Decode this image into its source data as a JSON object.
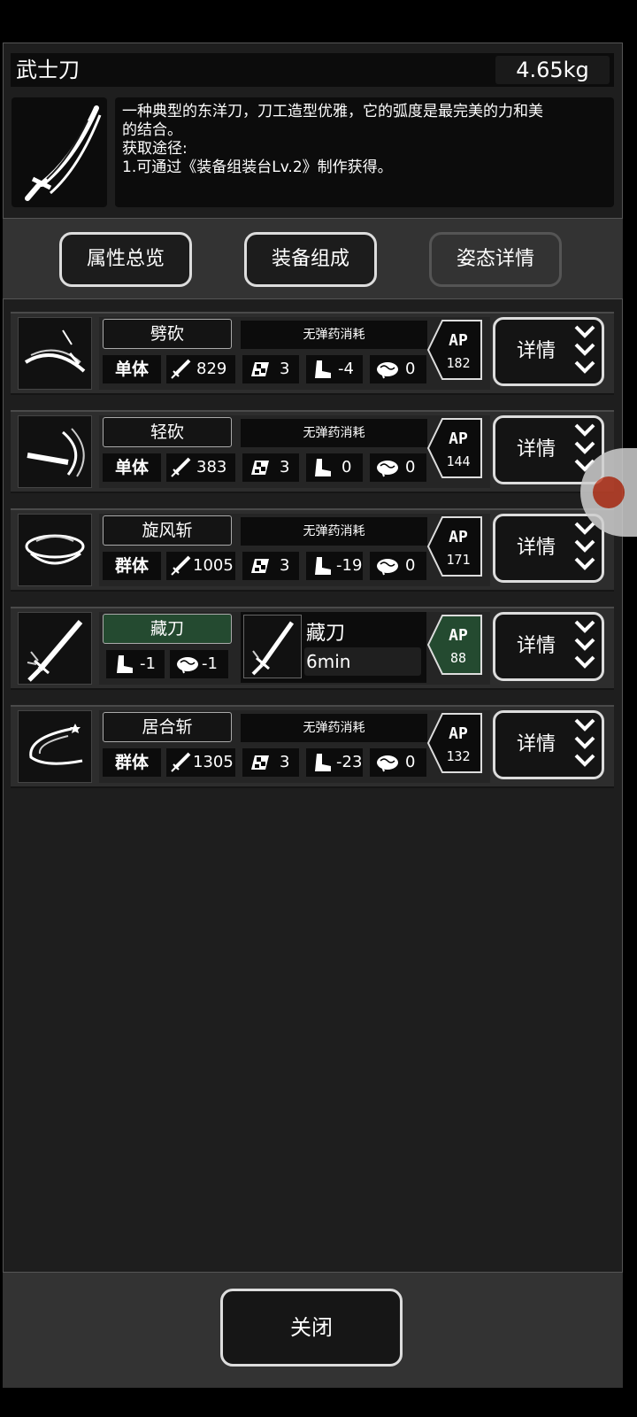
{
  "item": {
    "name": "武士刀",
    "weight": "4.65kg",
    "description_lines": [
      "一种典型的东洋刀，刀工造型优雅，它的弧度是最完美的力和美",
      "的结合。",
      "获取途径:",
      "1.可通过《装备组装台Lv.2》制作获得。"
    ]
  },
  "tabs": [
    {
      "label": "属性总览"
    },
    {
      "label": "装备组成"
    },
    {
      "label": "姿态详情",
      "selected": true
    }
  ],
  "skills": [
    {
      "name": "劈砍",
      "ammo": "无弹药消耗",
      "target": "单体",
      "attack": "829",
      "speed": "3",
      "move": "-4",
      "brain": "0",
      "ap_label": "AP",
      "ap": "182",
      "detail": "详情"
    },
    {
      "name": "轻砍",
      "ammo": "无弹药消耗",
      "target": "单体",
      "attack": "383",
      "speed": "3",
      "move": "0",
      "brain": "0",
      "ap_label": "AP",
      "ap": "144",
      "detail": "详情"
    },
    {
      "name": "旋风斩",
      "ammo": "无弹药消耗",
      "target": "群体",
      "attack": "1005",
      "speed": "3",
      "move": "-19",
      "brain": "0",
      "ap_label": "AP",
      "ap": "171",
      "detail": "详情"
    },
    {
      "name": "藏刀",
      "stance_name": "藏刀",
      "stance_time": "6min",
      "move": "-1",
      "brain": "-1",
      "ap_label": "AP",
      "ap": "88",
      "detail": "详情"
    },
    {
      "name": "居合斩",
      "ammo": "无弹药消耗",
      "target": "群体",
      "attack": "1305",
      "speed": "3",
      "move": "-23",
      "brain": "0",
      "ap_label": "AP",
      "ap": "132",
      "detail": "详情"
    }
  ],
  "footer": {
    "close_label": "关闭"
  },
  "colors": {
    "panel": "#1e1e1e",
    "stance_green": "#244a30",
    "button_border": "#dddddd"
  }
}
